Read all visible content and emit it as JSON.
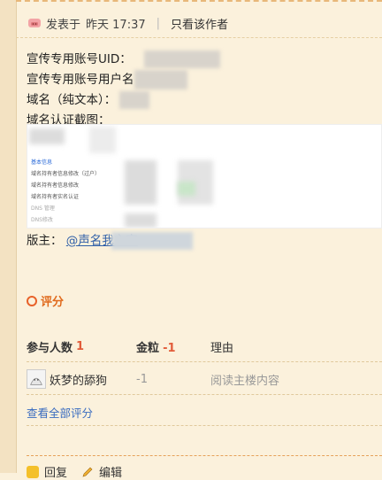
{
  "post": {
    "posted_label": "发表于",
    "posted_time": "昨天 17:37",
    "separator": "|",
    "author_only": "只看该作者"
  },
  "content": {
    "line1_label": "宣传专用账号UID：",
    "line2_label": "宣传专用账号用户名",
    "line3_label": "域名（纯文本）：",
    "line4_label": "域名认证截图："
  },
  "screenshot": {
    "menu_items": [
      "基本信息",
      "域名持有者信息修改（过户）",
      "域名持有者信息修改",
      "域名持有者实名认证",
      "DNS 管理",
      "DNS修改"
    ]
  },
  "moderator": {
    "label": "版主：",
    "link": "@声名我主宰"
  },
  "rating": {
    "title": "评分",
    "headers": {
      "participants": "参与人数",
      "participants_count": "1",
      "gold": "金粒",
      "gold_total": "-1",
      "reason": "理由"
    },
    "entries": [
      {
        "user": "妖梦的舔狗",
        "gold": "-1",
        "reason": "阅读主楼内容"
      }
    ],
    "view_all": "查看全部评分"
  },
  "footer": {
    "reply": "回复",
    "edit": "编辑"
  },
  "colors": {
    "background": "#fbf1dc",
    "accent_orange": "#e06a1c",
    "link_blue": "#3a6cc0",
    "negative_red": "#e25c3a"
  }
}
